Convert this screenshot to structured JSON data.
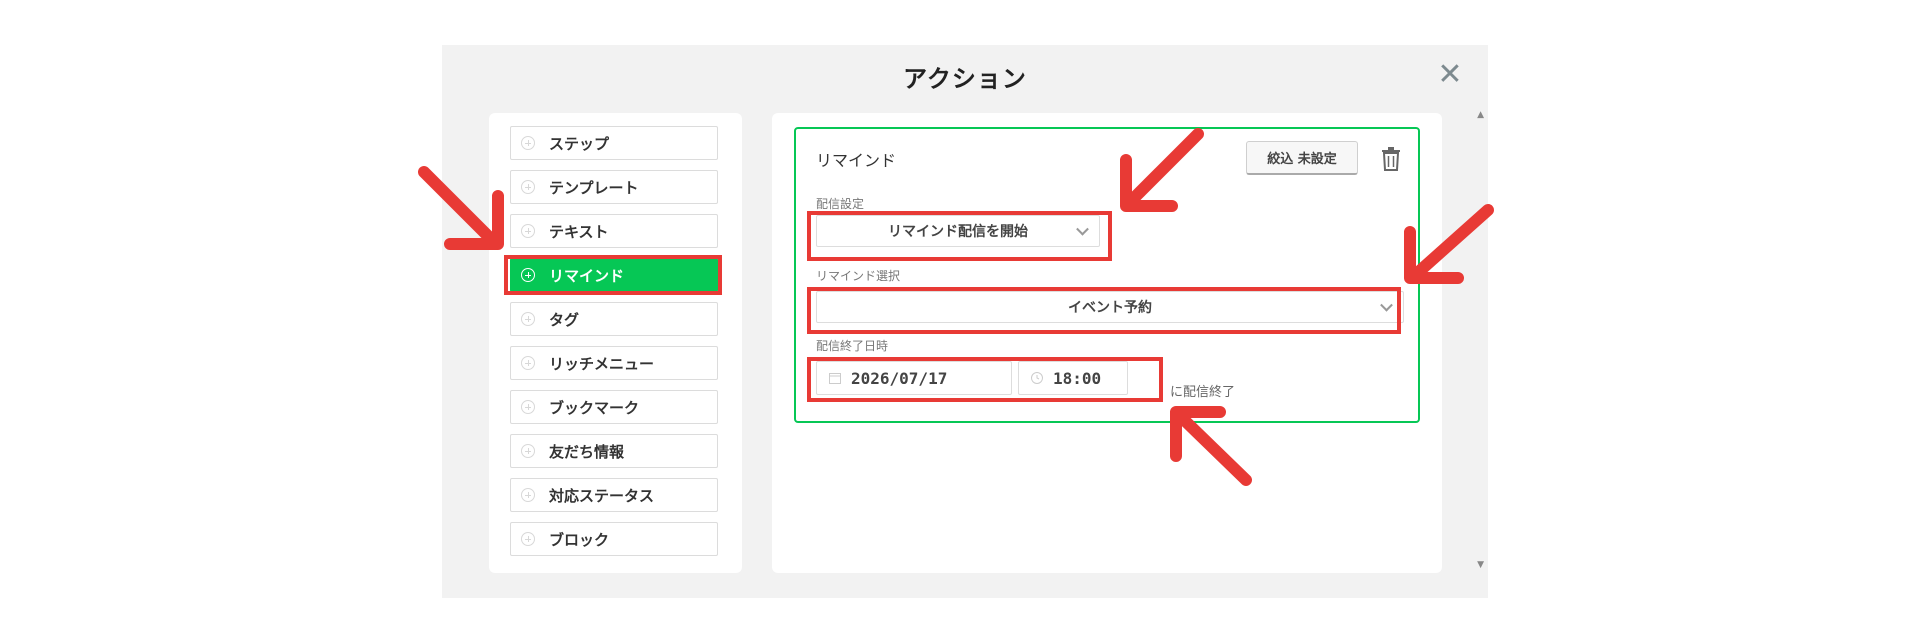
{
  "modal": {
    "title": "アクション",
    "close": "✕"
  },
  "actions": [
    {
      "label": "ステップ",
      "active": false
    },
    {
      "label": "テンプレート",
      "active": false
    },
    {
      "label": "テキスト",
      "active": false
    },
    {
      "label": "リマインド",
      "active": true
    },
    {
      "label": "タグ",
      "active": false
    },
    {
      "label": "リッチメニュー",
      "active": false
    },
    {
      "label": "ブックマーク",
      "active": false
    },
    {
      "label": "友だち情報",
      "active": false
    },
    {
      "label": "対応ステータス",
      "active": false
    },
    {
      "label": "ブロック",
      "active": false
    }
  ],
  "card": {
    "title": "リマインド",
    "filter_button": "絞込 未設定",
    "delivery_setting_label": "配信設定",
    "delivery_setting_value": "リマインド配信を開始",
    "remind_select_label": "リマインド選択",
    "remind_select_value": "イベント予約",
    "end_datetime_label": "配信終了日時",
    "end_date": "2026/07/17",
    "end_time": "18:00",
    "end_suffix": "に配信終了"
  },
  "colors": {
    "accent_green": "#06c755",
    "highlight_red": "#e83a35",
    "modal_bg": "#f2f2f2"
  }
}
